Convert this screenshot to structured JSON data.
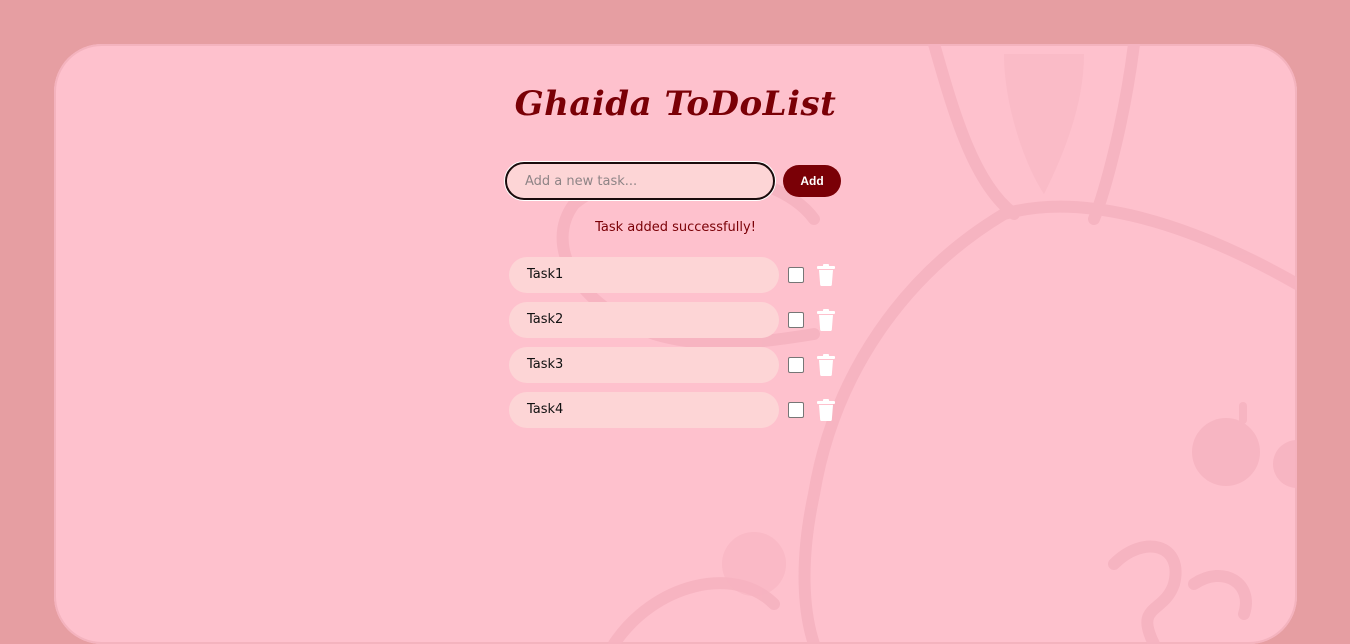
{
  "app": {
    "title": "Ghaida ToDoList"
  },
  "input": {
    "placeholder": "Add a new task...",
    "value": ""
  },
  "add_button": {
    "label": "Add"
  },
  "status_message": "Task added successfully!",
  "tasks": [
    {
      "label": "Task1",
      "checked": false
    },
    {
      "label": "Task2",
      "checked": false
    },
    {
      "label": "Task3",
      "checked": false
    },
    {
      "label": "Task4",
      "checked": false
    }
  ],
  "icons": {
    "delete": "trash-icon"
  },
  "colors": {
    "page_background": "#e69ea2",
    "card_background": "#fec1cd",
    "accent": "#7a0006",
    "field_background": "#fdd5d6"
  }
}
